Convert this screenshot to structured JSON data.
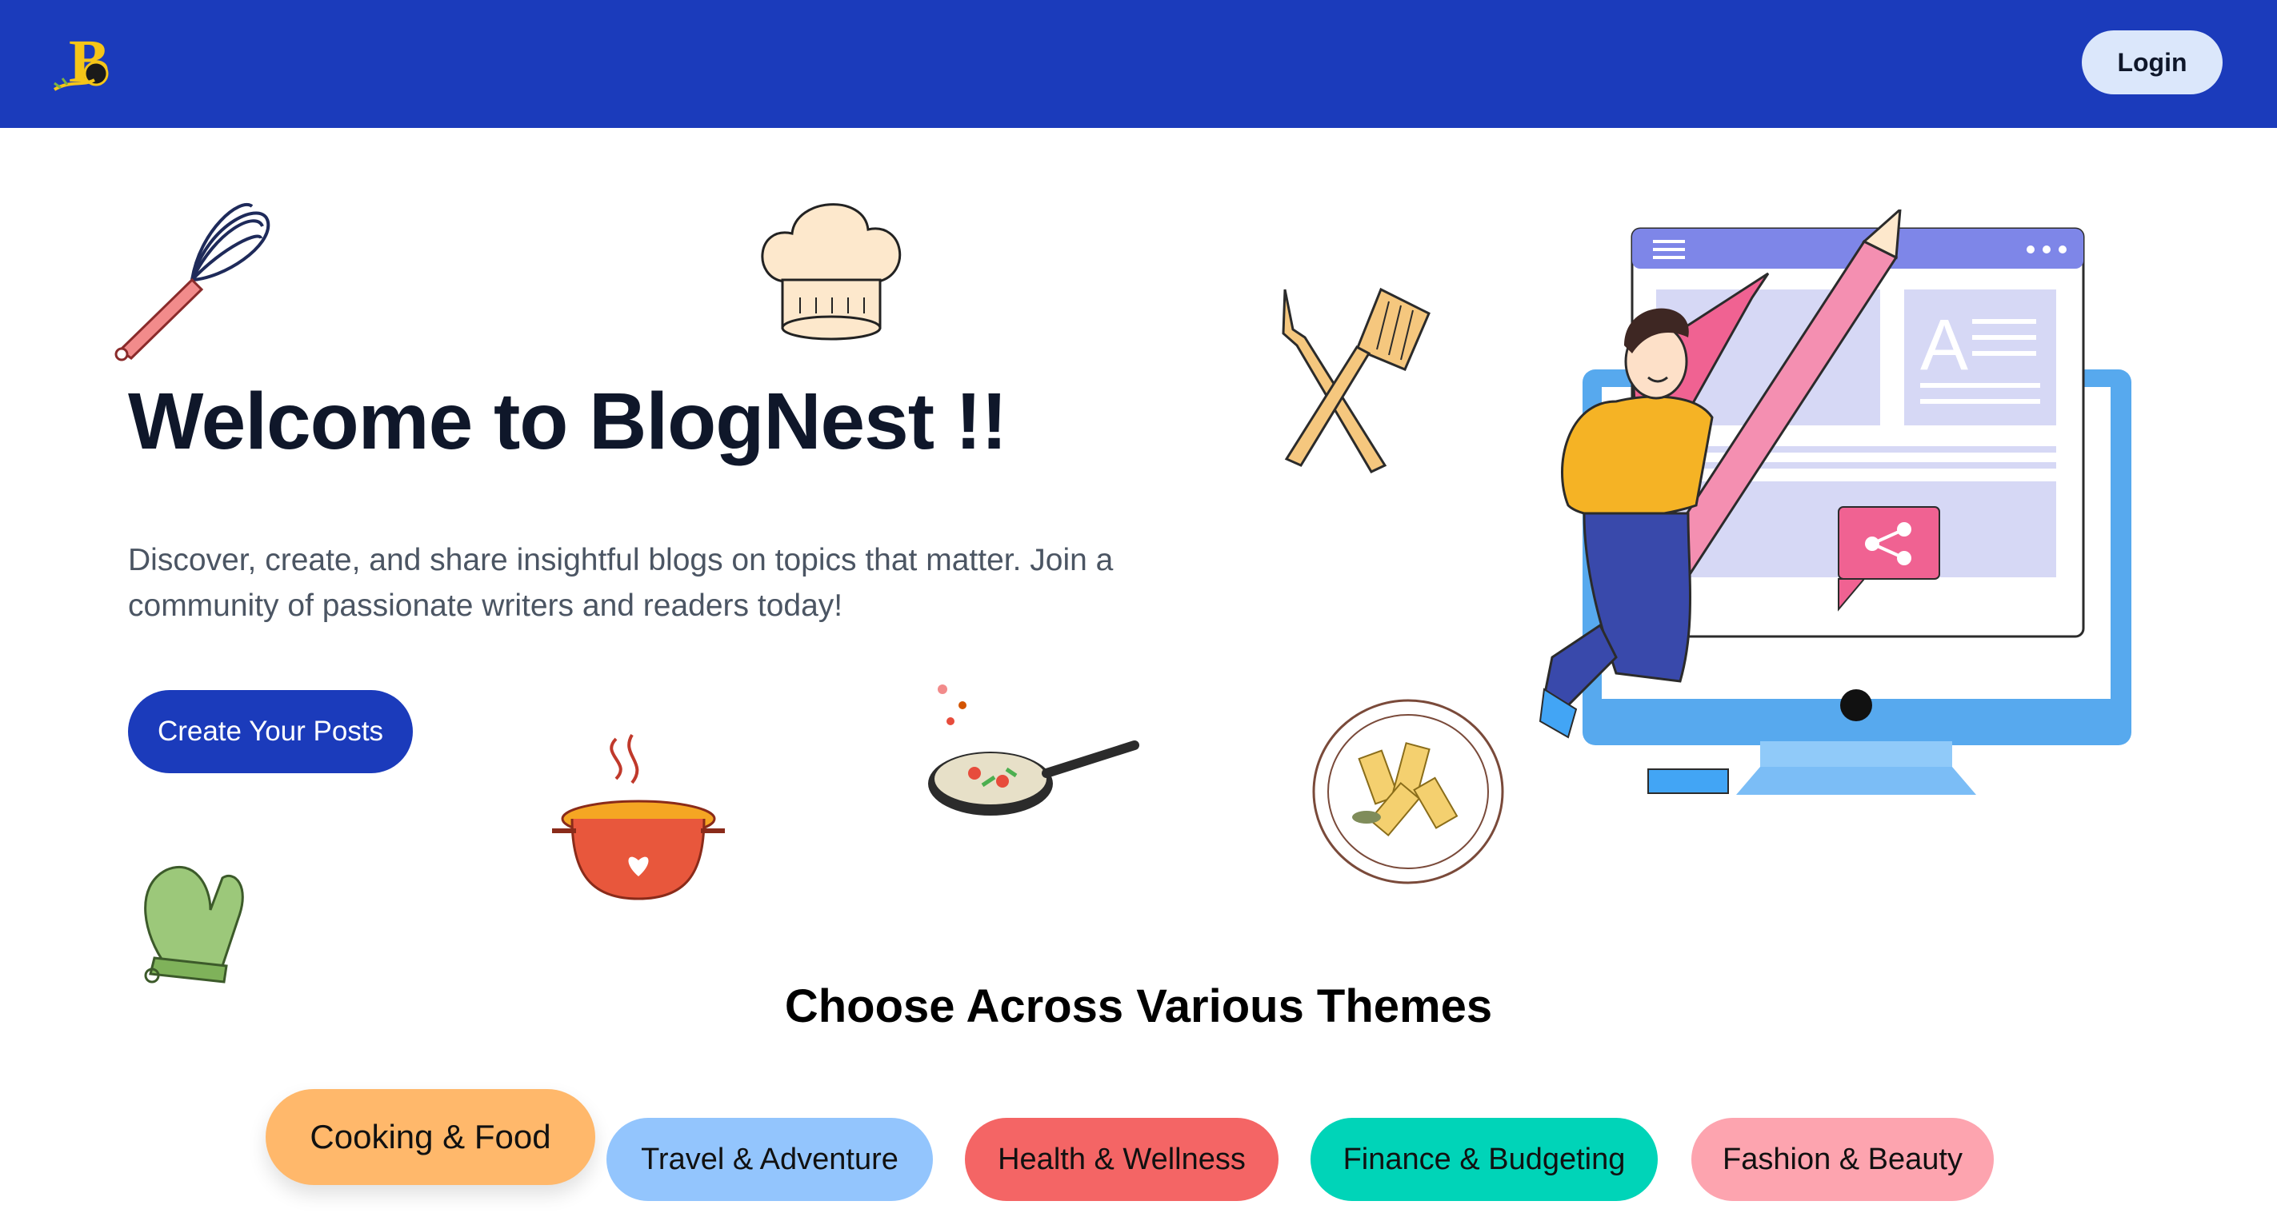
{
  "header": {
    "logo_letter": "B",
    "login_label": "Login"
  },
  "hero": {
    "title": "Welcome to BlogNest !!",
    "subtitle": "Discover, create, and share insightful blogs on topics that matter. Join a community of passionate writers and readers today!",
    "cta_label": "Create Your Posts"
  },
  "themes": {
    "heading": "Choose Across Various Themes",
    "items": [
      {
        "label": "Cooking & Food",
        "color": "#ffb86b",
        "selected": true
      },
      {
        "label": "Travel & Adventure",
        "color": "#93c5fd",
        "selected": false
      },
      {
        "label": "Health & Wellness",
        "color": "#f46565",
        "selected": false
      },
      {
        "label": "Finance & Budgeting",
        "color": "#00d4b8",
        "selected": false
      },
      {
        "label": "Fashion & Beauty",
        "color": "#fda4af",
        "selected": false
      }
    ]
  },
  "icons": [
    "whisk-icon",
    "chef-hat-icon",
    "fork-spatula-icon",
    "oven-mitt-icon",
    "cooking-pot-icon",
    "frying-pan-icon",
    "pasta-plate-icon",
    "hero-illustration"
  ],
  "colors": {
    "brand": "#1b3bbb",
    "login_bg": "#dbe7fb"
  }
}
